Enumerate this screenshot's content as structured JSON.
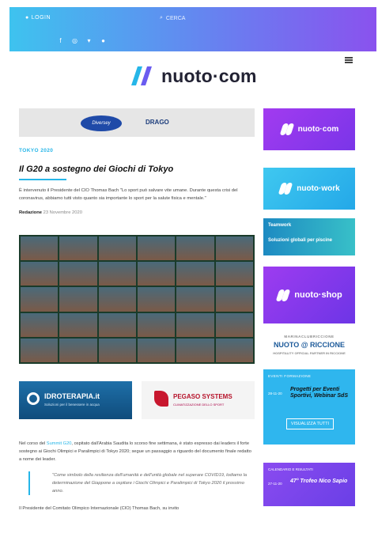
{
  "topbar": {
    "login_label": "LOGIN",
    "search_label": "CERCA",
    "social": [
      "facebook-icon",
      "instagram-icon",
      "twitter-icon",
      "youtube-icon"
    ]
  },
  "brand": {
    "logo_text": "nuoto·com",
    "accent": "#26b6e8",
    "purple": "#8a52ee"
  },
  "ad_top": {
    "left_logo": "Diversey",
    "right_logo": "DRAGO"
  },
  "article": {
    "category": "TOKYO 2020",
    "title": "Il G20 a sostegno dei Giochi di Tokyo",
    "excerpt": "È intervenuto il Presidente del CIO Thomas Bach \"Lo sport può salvare vite umane. Durante questa crisi del coronavirus, abbiamo tutti visto quanto sia importante lo sport per la salute fisica e mentale.\"",
    "author": "Redazione",
    "date": "23 Novembre 2020",
    "body_link": "Summit G20",
    "body_1a": "Nel corso del",
    "body_1b": ", ospitato dall'Arabia Saudita lo scorso fine settimana, è stato espresso dai leaders il forte sostegno ai Giochi Olimpici e Paralimpici di Tokyo 2020; segue un passaggio a riguardo del documento finale redatto a nome dei leader.",
    "quote": "\"Come simbolo della resilienza dell'umanità e dell'unità globale nel superare COVID19, lodiamo la determinazione del Giappone a ospitare i Giochi Olimpici e Paralimpici di Tokyo 2020 il prossimo anno.",
    "body_2": "Il Presidente del Comitato Olimpico Internazionale (CIO) Thomas Bach, su invito"
  },
  "ads_row": [
    {
      "title": "IDROTERAPIA.it",
      "subtitle": "Soluzioni per il benessere in acqua"
    },
    {
      "title": "PEGASO SYSTEMS",
      "subtitle": "CLIMATIZZAZIONE DELLO SPORT"
    }
  ],
  "sidebar": {
    "banner_nuoto_com": "nuoto·com",
    "banner_nuoto_work": "nuoto·work",
    "banner_teamwork_brand": "Teamwork",
    "banner_teamwork_text": "Soluzioni globali per piscine",
    "banner_nuoto_shop": "nuoto·shop",
    "riccione_top": "MARINACLUBRICCIONE",
    "riccione_title": "NUOTO @ RICCIONE",
    "riccione_sub": "HOSPITALITY OFFICIAL PARTNER IN RICCIONE",
    "events_header": "EVENTI FORMAZIONE",
    "event_date": "28-11-20",
    "event_name": "Progetti per Eventi Sportivi, Webinar SdS",
    "events_button": "VISUALIZZA TUTTI",
    "calendar_header": "CALENDARIO E RISULTATI",
    "calendar_date": "27-11-20",
    "calendar_name": "47° Trofeo Nico Sapio"
  }
}
